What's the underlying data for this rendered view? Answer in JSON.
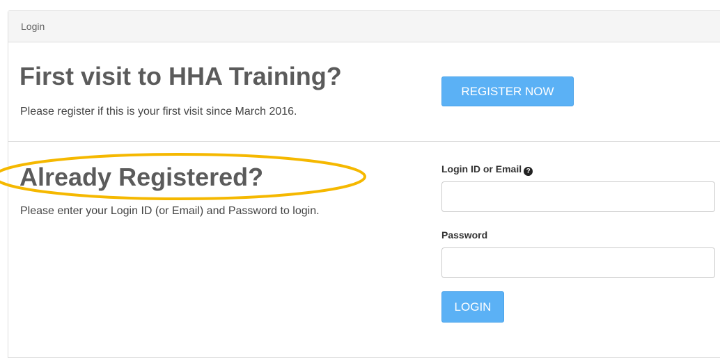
{
  "panel": {
    "heading": "Login"
  },
  "first_visit": {
    "title": "First visit to HHA Training?",
    "subtitle": "Please register if this is your first visit since March 2016.",
    "register_button": "REGISTER NOW"
  },
  "already_registered": {
    "title": "Already Registered?",
    "subtitle": "Please enter your Login ID (or Email) and Password to login."
  },
  "login_form": {
    "login_id_label": "Login ID or Email",
    "login_id_value": "",
    "login_id_help_icon": "question-circle-icon",
    "password_label": "Password",
    "password_value": "",
    "login_button": "LOGIN"
  },
  "colors": {
    "button_primary": "#5bb1f5",
    "highlight_ellipse": "#f5b800"
  }
}
